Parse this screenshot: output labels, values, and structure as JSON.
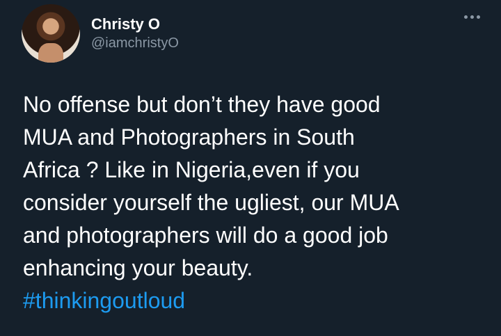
{
  "author": {
    "display_name": "Christy O",
    "handle": "@iamchristyO"
  },
  "tweet": {
    "text": "No offense but don’t they have good\nMUA and Photographers in South\nAfrica ? Like in Nigeria,even if you\nconsider yourself the ugliest, our MUA\nand photographers will do a good job\nenhancing your beauty.",
    "hashtag": "#thinkingoutloud"
  },
  "icons": {
    "more": "more-horizontal-icon"
  },
  "colors": {
    "background": "#15202b",
    "text": "#ffffff",
    "secondary_text": "#8b98a5",
    "link": "#1d9bf0"
  }
}
